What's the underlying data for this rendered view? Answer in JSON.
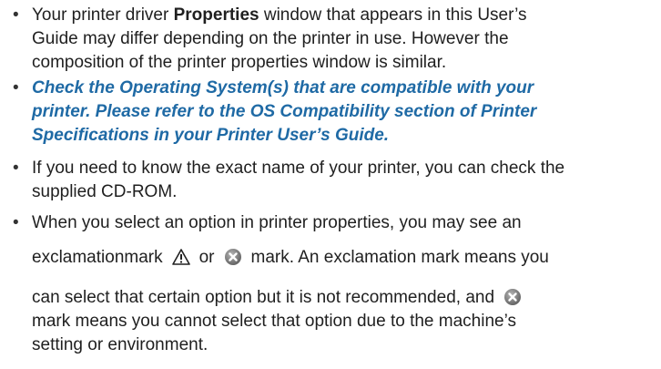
{
  "accent_color": "#1f6aa5",
  "bullet_glyph": "•",
  "items": [
    {
      "line1_pre": "Your printer driver ",
      "line1_bold": "Properties",
      "line1_post": " window that appears in this User’s",
      "line2": "Guide may differ depending on the printer in use. However the",
      "line3": "composition of the printer properties window is similar."
    },
    {
      "line1": "Check the Operating System(s) that are compatible with your",
      "line2": "printer. Please refer to the OS Compatibility section of Printer",
      "line3": "Specifications in your Printer User’s Guide."
    },
    {
      "line1": "If you need to know the exact name of your printer, you can check the",
      "line2": "supplied CD-ROM."
    },
    {
      "line1": "When you select an option in printer properties, you may see an",
      "line2_a": "exclamationmark",
      "line2_b": "or",
      "line2_c": "mark. An exclamation mark means you",
      "line3_a": "can select that certain option but it is not recommended, and",
      "line4": "mark means you cannot select that option due to the machine’s",
      "line5": "setting or environment."
    }
  ],
  "icons": {
    "warning": "exclamation-warning-icon",
    "error": "x-circle-icon"
  }
}
